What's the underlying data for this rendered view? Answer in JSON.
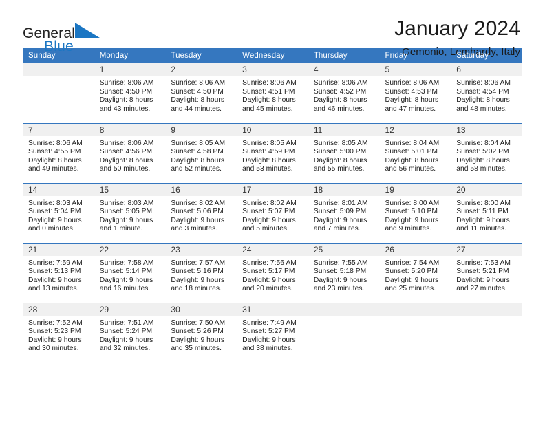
{
  "brand": {
    "name_part1": "General",
    "name_part2": "Blue",
    "flag_icon": "triangle-flag-icon"
  },
  "header": {
    "month_title": "January 2024",
    "location": "Gemonio, Lombardy, Italy"
  },
  "calendar": {
    "weekday_headers": [
      "Sunday",
      "Monday",
      "Tuesday",
      "Wednesday",
      "Thursday",
      "Friday",
      "Saturday"
    ],
    "accent_color": "#3577bf",
    "daynum_bg": "#f0f0f0",
    "weeks": [
      [
        {
          "day": "",
          "sunrise": "",
          "sunset": "",
          "daylight1": "",
          "daylight2": ""
        },
        {
          "day": "1",
          "sunrise": "Sunrise: 8:06 AM",
          "sunset": "Sunset: 4:50 PM",
          "daylight1": "Daylight: 8 hours",
          "daylight2": "and 43 minutes."
        },
        {
          "day": "2",
          "sunrise": "Sunrise: 8:06 AM",
          "sunset": "Sunset: 4:50 PM",
          "daylight1": "Daylight: 8 hours",
          "daylight2": "and 44 minutes."
        },
        {
          "day": "3",
          "sunrise": "Sunrise: 8:06 AM",
          "sunset": "Sunset: 4:51 PM",
          "daylight1": "Daylight: 8 hours",
          "daylight2": "and 45 minutes."
        },
        {
          "day": "4",
          "sunrise": "Sunrise: 8:06 AM",
          "sunset": "Sunset: 4:52 PM",
          "daylight1": "Daylight: 8 hours",
          "daylight2": "and 46 minutes."
        },
        {
          "day": "5",
          "sunrise": "Sunrise: 8:06 AM",
          "sunset": "Sunset: 4:53 PM",
          "daylight1": "Daylight: 8 hours",
          "daylight2": "and 47 minutes."
        },
        {
          "day": "6",
          "sunrise": "Sunrise: 8:06 AM",
          "sunset": "Sunset: 4:54 PM",
          "daylight1": "Daylight: 8 hours",
          "daylight2": "and 48 minutes."
        }
      ],
      [
        {
          "day": "7",
          "sunrise": "Sunrise: 8:06 AM",
          "sunset": "Sunset: 4:55 PM",
          "daylight1": "Daylight: 8 hours",
          "daylight2": "and 49 minutes."
        },
        {
          "day": "8",
          "sunrise": "Sunrise: 8:06 AM",
          "sunset": "Sunset: 4:56 PM",
          "daylight1": "Daylight: 8 hours",
          "daylight2": "and 50 minutes."
        },
        {
          "day": "9",
          "sunrise": "Sunrise: 8:05 AM",
          "sunset": "Sunset: 4:58 PM",
          "daylight1": "Daylight: 8 hours",
          "daylight2": "and 52 minutes."
        },
        {
          "day": "10",
          "sunrise": "Sunrise: 8:05 AM",
          "sunset": "Sunset: 4:59 PM",
          "daylight1": "Daylight: 8 hours",
          "daylight2": "and 53 minutes."
        },
        {
          "day": "11",
          "sunrise": "Sunrise: 8:05 AM",
          "sunset": "Sunset: 5:00 PM",
          "daylight1": "Daylight: 8 hours",
          "daylight2": "and 55 minutes."
        },
        {
          "day": "12",
          "sunrise": "Sunrise: 8:04 AM",
          "sunset": "Sunset: 5:01 PM",
          "daylight1": "Daylight: 8 hours",
          "daylight2": "and 56 minutes."
        },
        {
          "day": "13",
          "sunrise": "Sunrise: 8:04 AM",
          "sunset": "Sunset: 5:02 PM",
          "daylight1": "Daylight: 8 hours",
          "daylight2": "and 58 minutes."
        }
      ],
      [
        {
          "day": "14",
          "sunrise": "Sunrise: 8:03 AM",
          "sunset": "Sunset: 5:04 PM",
          "daylight1": "Daylight: 9 hours",
          "daylight2": "and 0 minutes."
        },
        {
          "day": "15",
          "sunrise": "Sunrise: 8:03 AM",
          "sunset": "Sunset: 5:05 PM",
          "daylight1": "Daylight: 9 hours",
          "daylight2": "and 1 minute."
        },
        {
          "day": "16",
          "sunrise": "Sunrise: 8:02 AM",
          "sunset": "Sunset: 5:06 PM",
          "daylight1": "Daylight: 9 hours",
          "daylight2": "and 3 minutes."
        },
        {
          "day": "17",
          "sunrise": "Sunrise: 8:02 AM",
          "sunset": "Sunset: 5:07 PM",
          "daylight1": "Daylight: 9 hours",
          "daylight2": "and 5 minutes."
        },
        {
          "day": "18",
          "sunrise": "Sunrise: 8:01 AM",
          "sunset": "Sunset: 5:09 PM",
          "daylight1": "Daylight: 9 hours",
          "daylight2": "and 7 minutes."
        },
        {
          "day": "19",
          "sunrise": "Sunrise: 8:00 AM",
          "sunset": "Sunset: 5:10 PM",
          "daylight1": "Daylight: 9 hours",
          "daylight2": "and 9 minutes."
        },
        {
          "day": "20",
          "sunrise": "Sunrise: 8:00 AM",
          "sunset": "Sunset: 5:11 PM",
          "daylight1": "Daylight: 9 hours",
          "daylight2": "and 11 minutes."
        }
      ],
      [
        {
          "day": "21",
          "sunrise": "Sunrise: 7:59 AM",
          "sunset": "Sunset: 5:13 PM",
          "daylight1": "Daylight: 9 hours",
          "daylight2": "and 13 minutes."
        },
        {
          "day": "22",
          "sunrise": "Sunrise: 7:58 AM",
          "sunset": "Sunset: 5:14 PM",
          "daylight1": "Daylight: 9 hours",
          "daylight2": "and 16 minutes."
        },
        {
          "day": "23",
          "sunrise": "Sunrise: 7:57 AM",
          "sunset": "Sunset: 5:16 PM",
          "daylight1": "Daylight: 9 hours",
          "daylight2": "and 18 minutes."
        },
        {
          "day": "24",
          "sunrise": "Sunrise: 7:56 AM",
          "sunset": "Sunset: 5:17 PM",
          "daylight1": "Daylight: 9 hours",
          "daylight2": "and 20 minutes."
        },
        {
          "day": "25",
          "sunrise": "Sunrise: 7:55 AM",
          "sunset": "Sunset: 5:18 PM",
          "daylight1": "Daylight: 9 hours",
          "daylight2": "and 23 minutes."
        },
        {
          "day": "26",
          "sunrise": "Sunrise: 7:54 AM",
          "sunset": "Sunset: 5:20 PM",
          "daylight1": "Daylight: 9 hours",
          "daylight2": "and 25 minutes."
        },
        {
          "day": "27",
          "sunrise": "Sunrise: 7:53 AM",
          "sunset": "Sunset: 5:21 PM",
          "daylight1": "Daylight: 9 hours",
          "daylight2": "and 27 minutes."
        }
      ],
      [
        {
          "day": "28",
          "sunrise": "Sunrise: 7:52 AM",
          "sunset": "Sunset: 5:23 PM",
          "daylight1": "Daylight: 9 hours",
          "daylight2": "and 30 minutes."
        },
        {
          "day": "29",
          "sunrise": "Sunrise: 7:51 AM",
          "sunset": "Sunset: 5:24 PM",
          "daylight1": "Daylight: 9 hours",
          "daylight2": "and 32 minutes."
        },
        {
          "day": "30",
          "sunrise": "Sunrise: 7:50 AM",
          "sunset": "Sunset: 5:26 PM",
          "daylight1": "Daylight: 9 hours",
          "daylight2": "and 35 minutes."
        },
        {
          "day": "31",
          "sunrise": "Sunrise: 7:49 AM",
          "sunset": "Sunset: 5:27 PM",
          "daylight1": "Daylight: 9 hours",
          "daylight2": "and 38 minutes."
        },
        {
          "day": "",
          "sunrise": "",
          "sunset": "",
          "daylight1": "",
          "daylight2": ""
        },
        {
          "day": "",
          "sunrise": "",
          "sunset": "",
          "daylight1": "",
          "daylight2": ""
        },
        {
          "day": "",
          "sunrise": "",
          "sunset": "",
          "daylight1": "",
          "daylight2": ""
        }
      ]
    ]
  }
}
